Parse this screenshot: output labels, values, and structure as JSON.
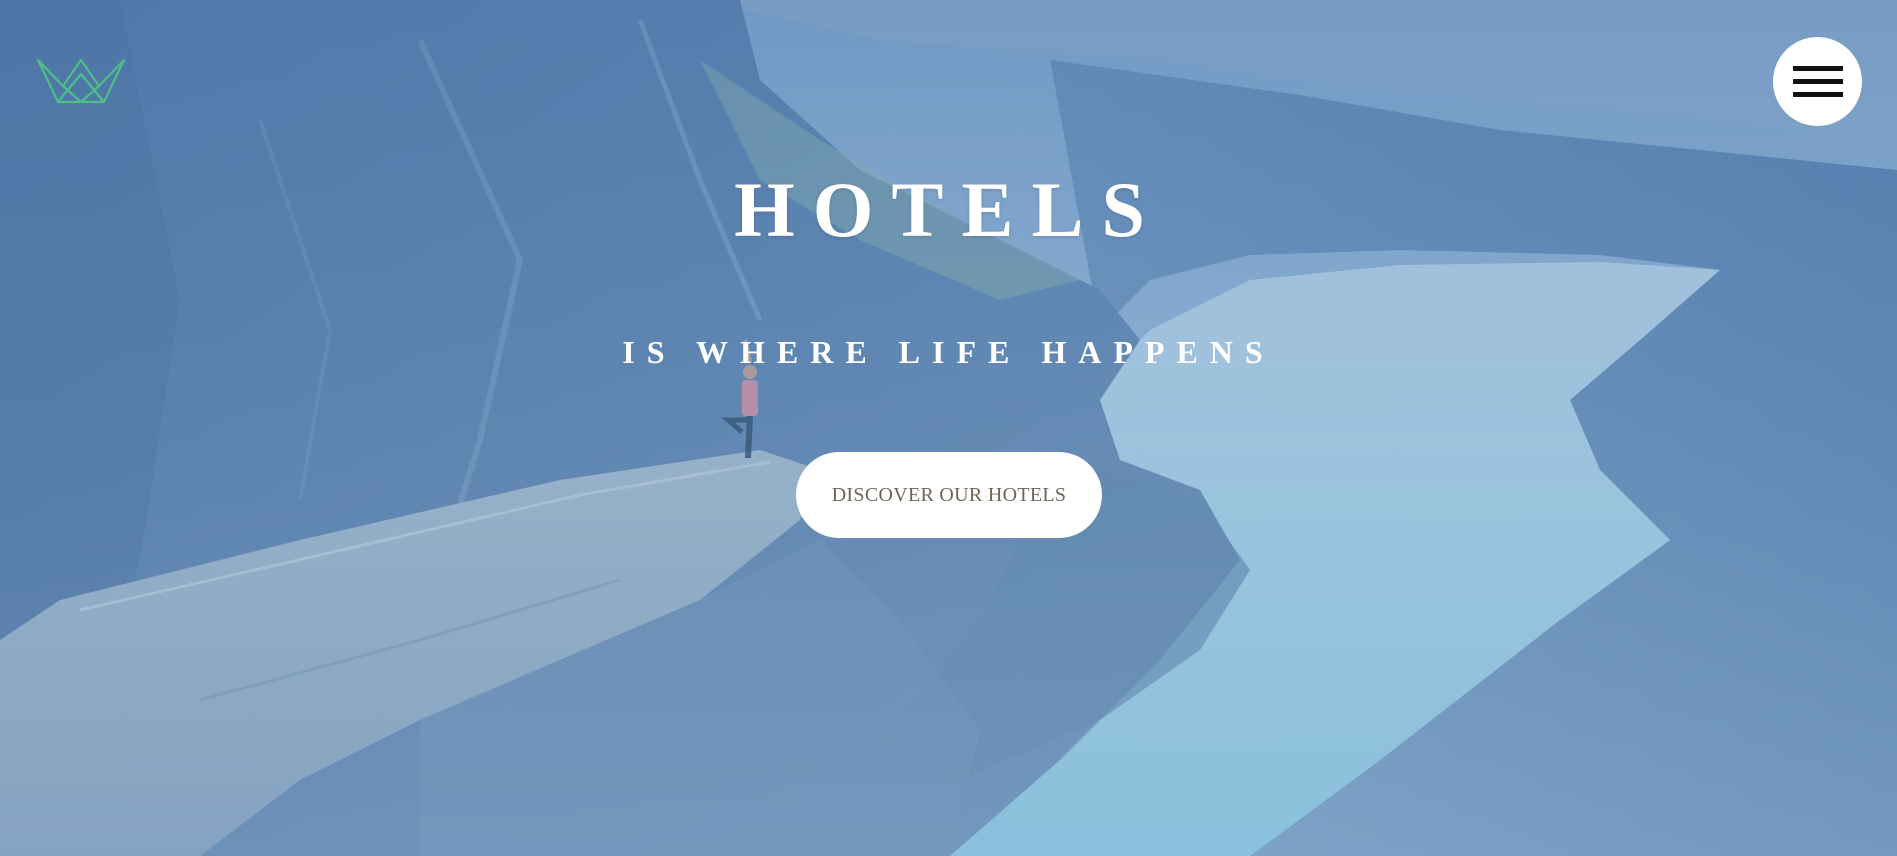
{
  "brand": {
    "logo_icon": "crown-icon",
    "logo_color": "#4dbf86"
  },
  "nav": {
    "menu_icon": "hamburger-menu-icon"
  },
  "hero": {
    "title": "HOTELS",
    "subtitle": "IS WHERE LIFE HAPPENS",
    "cta_label": "DISCOVER OUR HOTELS",
    "background_image": "fjord-cliff-yoga-photo"
  },
  "colors": {
    "overlay_tint": "#6d93bd",
    "text": "#ffffff",
    "button_bg": "#ffffff",
    "button_text": "#6e6558"
  }
}
